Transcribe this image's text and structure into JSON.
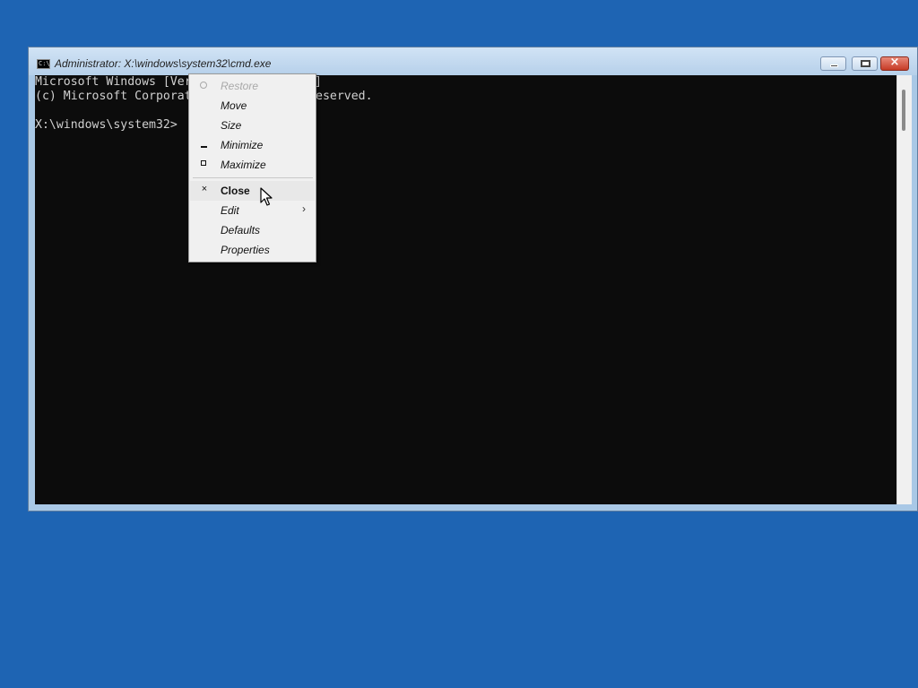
{
  "window": {
    "title": "Administrator: X:\\windows\\system32\\cmd.exe",
    "buttons": {
      "minimize": "minimize",
      "maximize": "maximize",
      "close": "×"
    }
  },
  "console": {
    "lines": [
      "Microsoft Windows [Ver",
      "(c) Microsoft Corporat",
      "",
      "X:\\windows\\system32>"
    ],
    "line_tails": [
      "]",
      "eserved."
    ]
  },
  "context_menu": {
    "items": [
      {
        "label": "Restore",
        "enabled": false,
        "icon": "restore-icon"
      },
      {
        "label": "Move",
        "enabled": true
      },
      {
        "label": "Size",
        "enabled": true
      },
      {
        "label": "Minimize",
        "enabled": true,
        "icon": "minimize-icon"
      },
      {
        "label": "Maximize",
        "enabled": true,
        "icon": "maximize-icon"
      },
      {
        "label": "Close",
        "enabled": true,
        "icon": "close-icon",
        "default": true
      },
      {
        "label": "Edit",
        "enabled": true,
        "submenu": true
      },
      {
        "label": "Defaults",
        "enabled": true
      },
      {
        "label": "Properties",
        "enabled": true
      }
    ],
    "close_glyph": "×",
    "submenu_glyph": "›"
  },
  "colors": {
    "desktop": "#1e64b3",
    "console_bg": "#0c0c0c",
    "console_text": "#d0d0d0",
    "close_button": "#c63b26"
  }
}
